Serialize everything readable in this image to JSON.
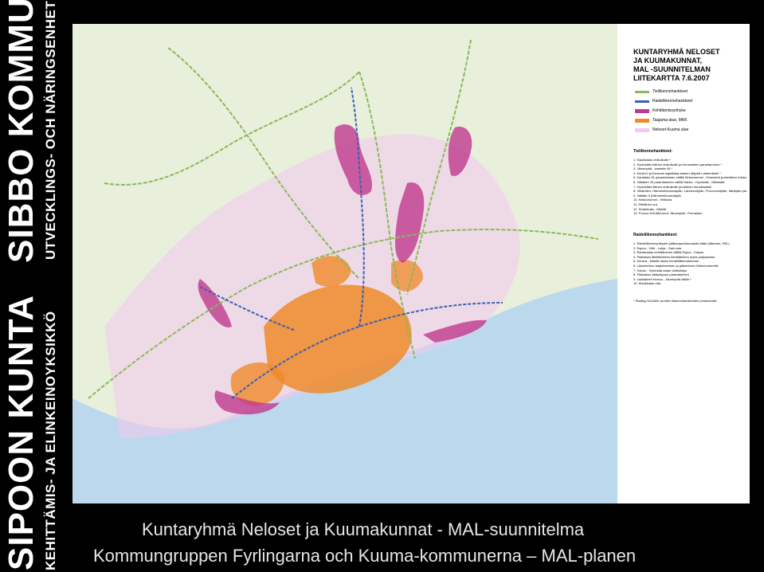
{
  "sidebar": {
    "sibbo_kommun": "SIBBO KOMMUN",
    "utveckling": "UTVECKLINGS- OCH NÄRINGSENHETEN",
    "sipoon_kunta": "SIPOON KUNTA",
    "kehittamis": "KEHITTÄMIS- JA ELINKEINOYKSIKKÖ"
  },
  "legend": {
    "title": "KUNTARYHMÄ NELOSET\nJA KUUMAKUNNAT,\nMAL -SUUNNITELMAN\nLIITEKARTTA 7.6.2007",
    "keys": [
      {
        "label": "Tieliikennehankkeet",
        "color": "#8ab85a"
      },
      {
        "label": "Raideliikennehankkeet",
        "color": "#3b5fb0"
      },
      {
        "label": "Kehittämisvyöhyke",
        "color": "#c0398f"
      },
      {
        "label": "Taajama-alue, MKK",
        "color": "#ef8a2a"
      },
      {
        "label": "Neloset-Kuuma alue",
        "color": "#f2c8ee"
      }
    ],
    "road_head": "Tieliikennehankkeet:",
    "road_items": [
      "1. Klaukkalan ohikulkutie *",
      "2. Hyvinkään itäinen ohikulkutie ja Keravantien parantaminen *",
      "3. Järvenpää - kantatie 45 *",
      "4. Kehä IV ja Keravan logistiikka-alueen liittymä Lahdentielle *",
      "5. Kantatien 51 parantaminen välillä Kirkkonummi - Kivenlahti ja eteläisen Kirkkonummen Kaisaniemi",
      "6. Valtatien 25 parantaminen välillä Hanko - Hyvinkää - Mäntsälä",
      "7. Hyvinkään itäinen ohikulkutie ja tähteen rinnakkaistie",
      "8. Vihdintien, Hämeenlinnanväylän, Lahdenväylän, Porvoonväylän, Itäväylän parantaminen",
      "9. Valtatie 3 (Hämeenlinnanväylä)",
      "10. Kirkkonummi - Veikkola",
      "11. Eteläinen ora",
      "12. Söderkulla - Nikkilä",
      "13. Porvoo KUUMA-kunt. Järvenpää - Pornainen"
    ],
    "rail_head": "Raideliikennehankkeet:",
    "rail_items": [
      "1. Raideliikenneyhteydet pääkaupunkiseudulta itään (Itämetro, HEL)",
      "2. Espoo - Vihti - Lohja - Salo rata",
      "3. Rantaradan kehittäminen välillä Espoo - Karjaa",
      "4. Pääradan lähiliikenteen kehittäminen myös pohjoisesta",
      "5. Kerava - Nikkilä radan henkilöliikennetunnel",
      "6. Länsimetron laajentaminen ja jatkaminen Kirkkonummelle",
      "7. Hanko - Hyvinkää radan sähköistys",
      "8. Pääradan välityskyvyn parantaminen",
      "9. Lisäraiteet Kerava - Järvenpää välille *",
      "10. Klaukkalan rata"
    ],
    "note": "* Sisältyy KUUMA -kuntien liikennehankkeiden priorisointiin"
  },
  "footer": {
    "line1": "Kuntaryhmä Neloset ja Kuumakunnat - MAL-suunnitelma",
    "line2": "Kommungruppen Fyrlingarna och Kuuma-kommunerna – MAL-planen"
  }
}
